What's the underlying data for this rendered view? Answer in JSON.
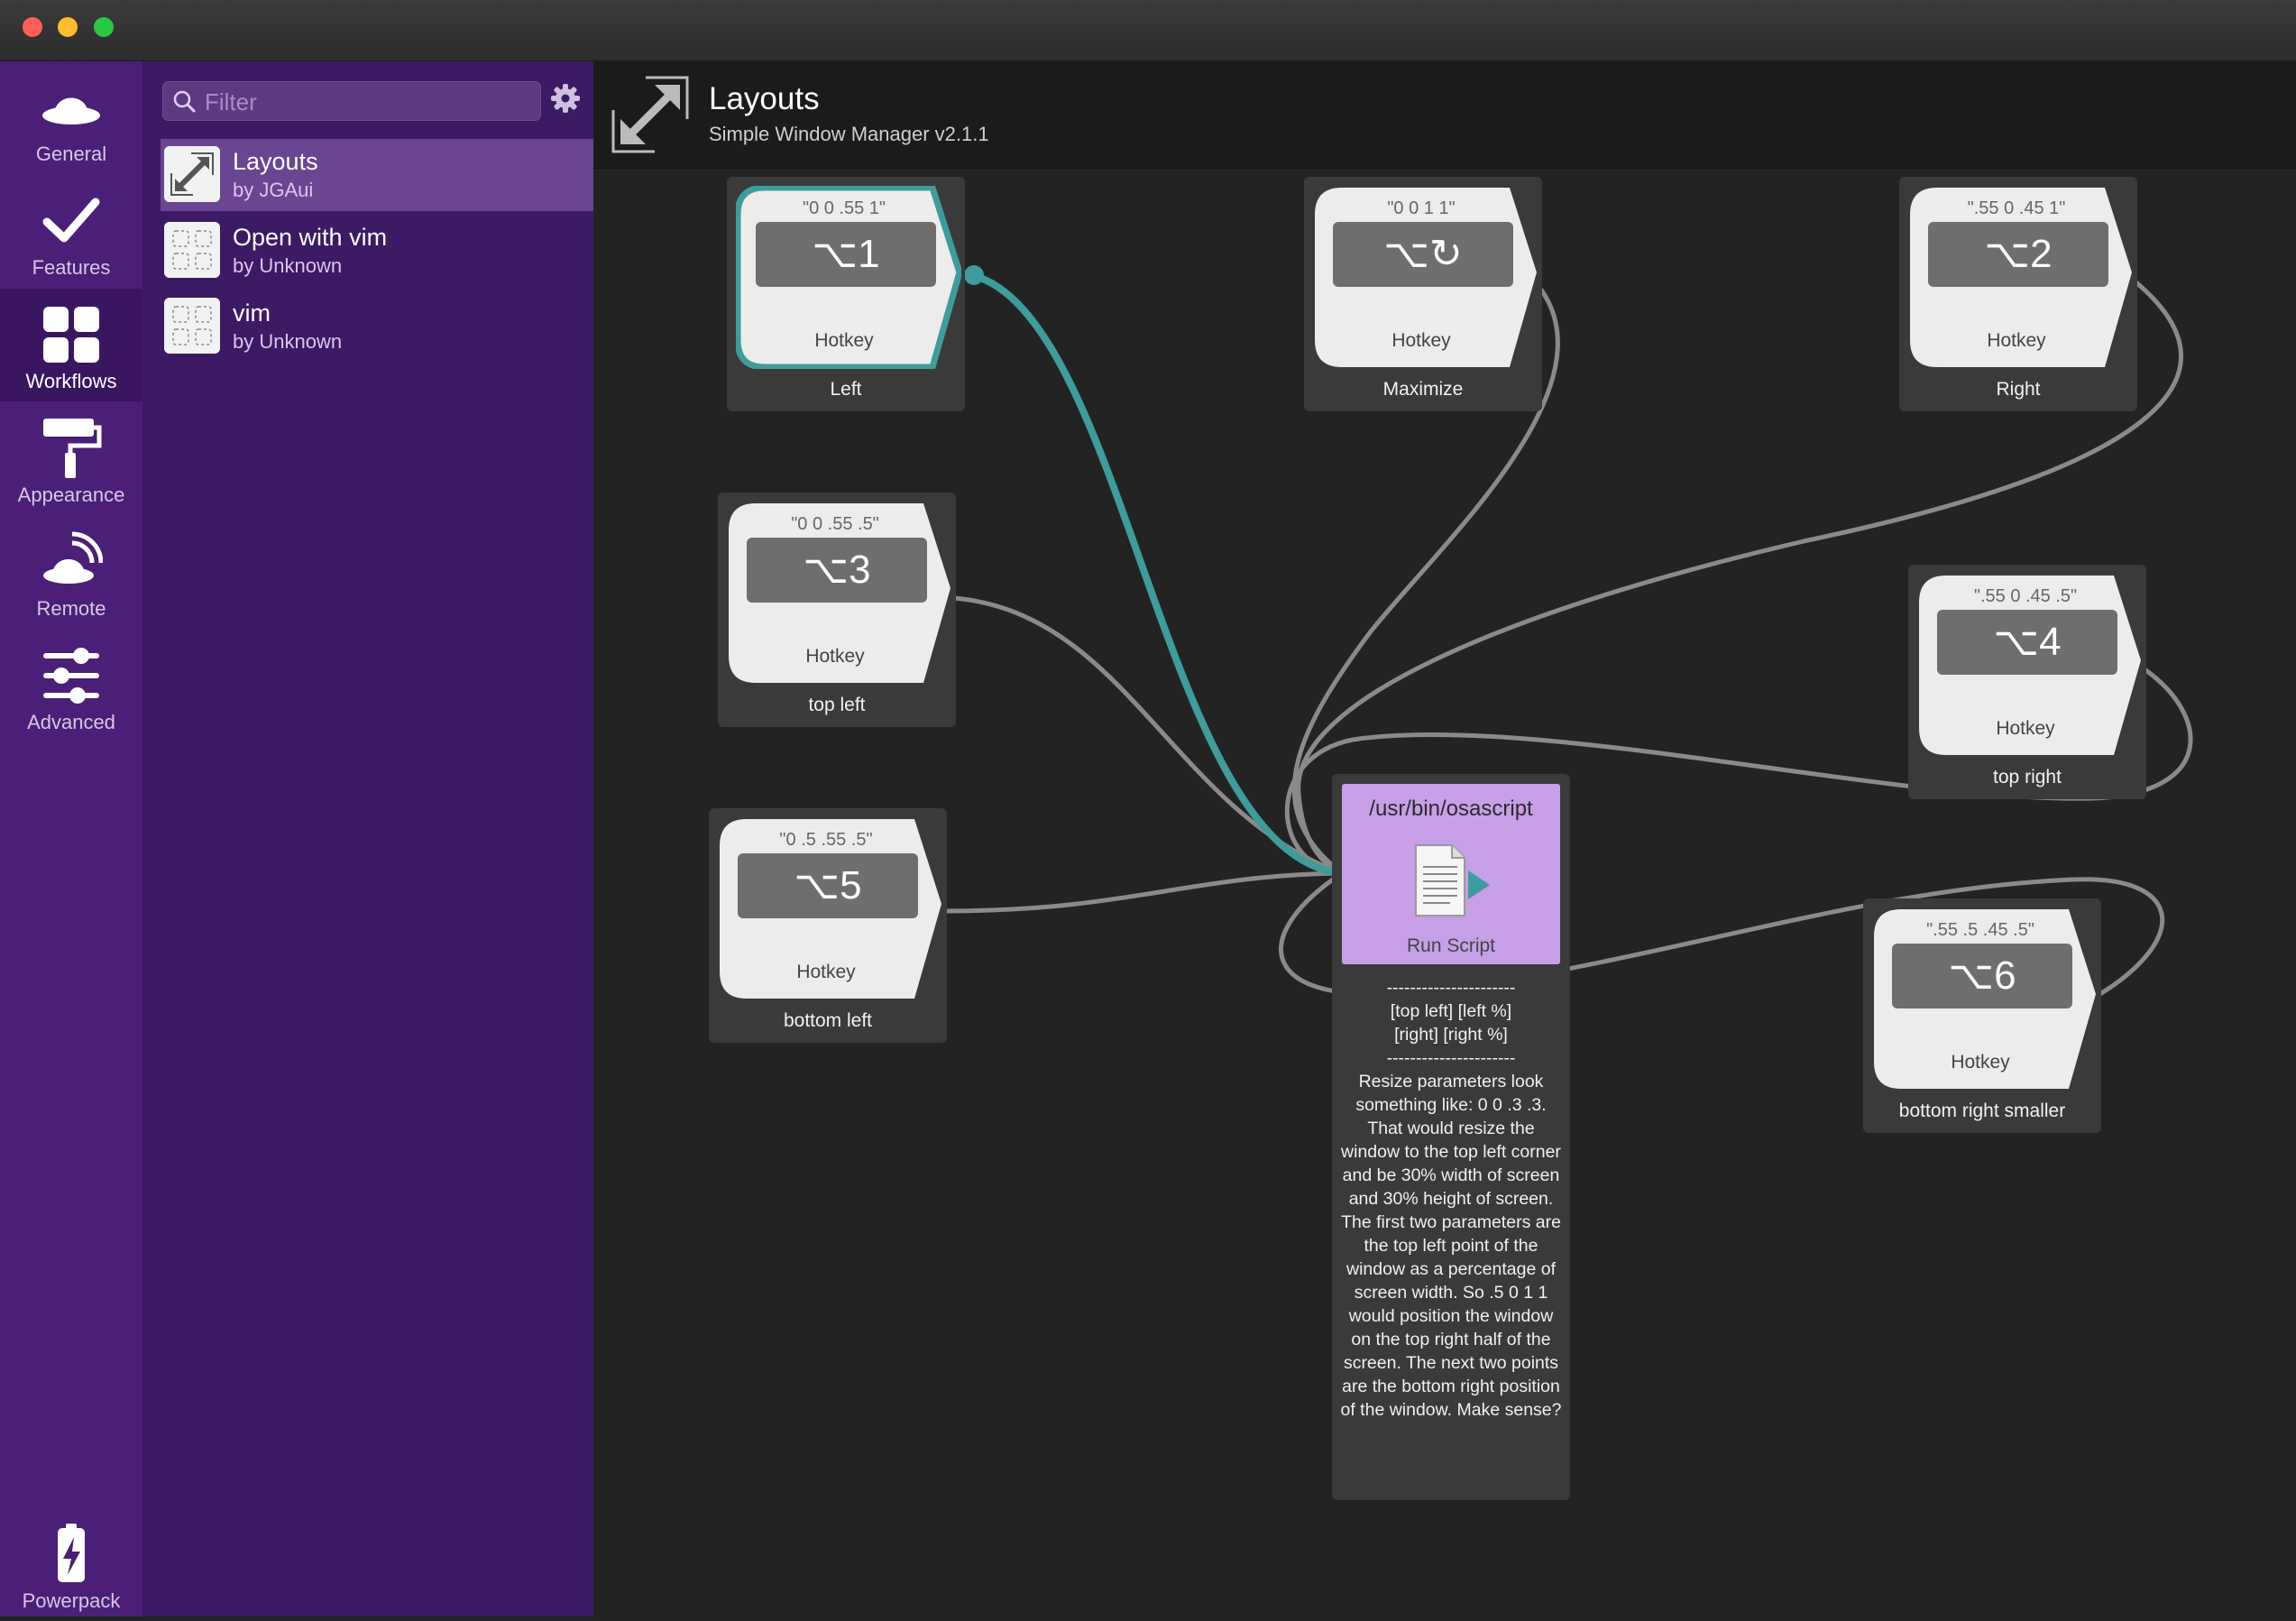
{
  "window": {
    "traffic_lights": {
      "close": "#fe5f57",
      "minimize": "#febc2e",
      "zoom": "#28c840"
    }
  },
  "nav": {
    "items": [
      {
        "label": "General",
        "icon": "hat-icon"
      },
      {
        "label": "Features",
        "icon": "checkmark-icon"
      },
      {
        "label": "Workflows",
        "icon": "grid-icon",
        "active": true
      },
      {
        "label": "Appearance",
        "icon": "paint-roller-icon"
      },
      {
        "label": "Remote",
        "icon": "remote-hat-icon"
      },
      {
        "label": "Advanced",
        "icon": "sliders-icon"
      }
    ],
    "powerpack_label": "Powerpack"
  },
  "list": {
    "filter_placeholder": "Filter",
    "items": [
      {
        "title": "Layouts",
        "author": "by JGAui",
        "selected": true
      },
      {
        "title": "Open with vim",
        "author": "by Unknown"
      },
      {
        "title": "vim",
        "author": "by Unknown"
      }
    ]
  },
  "header": {
    "title": "Layouts",
    "subtitle": "Simple Window Manager v2.1.1"
  },
  "nodes": [
    {
      "id": "left",
      "args": "\"0 0 .55 1\"",
      "key": "⌥1",
      "type": "Hotkey",
      "name": "Left",
      "selected": true
    },
    {
      "id": "maximize",
      "args": "\"0 0 1 1\"",
      "key": "⌥↻",
      "type": "Hotkey",
      "name": "Maximize"
    },
    {
      "id": "right",
      "args": "\".55 0 .45 1\"",
      "key": "⌥2",
      "type": "Hotkey",
      "name": "Right"
    },
    {
      "id": "top-left",
      "args": "\"0 0 .55 .5\"",
      "key": "⌥3",
      "type": "Hotkey",
      "name": "top left"
    },
    {
      "id": "top-right",
      "args": "\".55 0 .45 .5\"",
      "key": "⌥4",
      "type": "Hotkey",
      "name": "top right"
    },
    {
      "id": "bottom-left",
      "args": "\"0 .5 .55 .5\"",
      "key": "⌥5",
      "type": "Hotkey",
      "name": "bottom left"
    },
    {
      "id": "bottom-right-smaller",
      "args": "\".55 .5 .45 .5\"",
      "key": "⌥6",
      "type": "Hotkey",
      "name": "bottom right smaller"
    }
  ],
  "script_node": {
    "path": "/usr/bin/osascript",
    "type": "Run Script",
    "note": "----------------------\n[top left] [left %]\n[right] [right %]\n----------------------\nResize parameters look something like: 0 0 .3 .3. That would resize the window to the top left corner and be 30% width of screen and 30% height of screen. The first two parameters are the top left point of the window as a percentage of screen width. So .5 0 1 1 would position the window on the top right half of the screen. The next two points are the bottom right position of the window. Make sense?"
  },
  "colors": {
    "accent_teal": "#3d9c9c",
    "nav_bg": "#4b1f77",
    "list_bg": "#3c1a64",
    "script_purple": "#c69fe6"
  }
}
